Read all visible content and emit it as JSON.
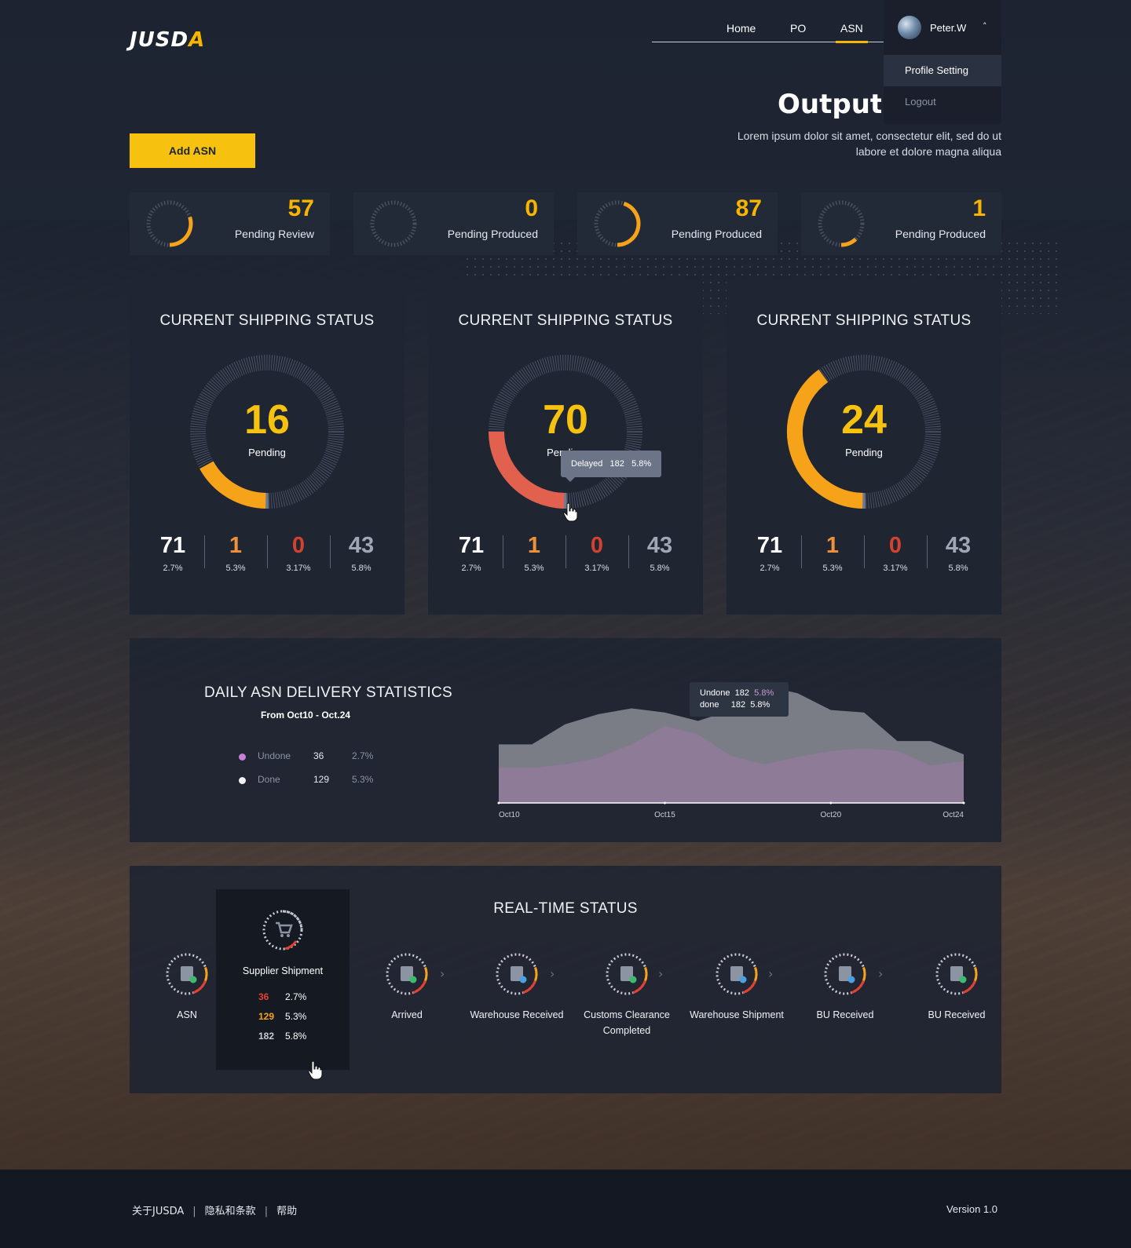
{
  "brand": {
    "logo_text_a": "JUSD",
    "logo_text_b": "A"
  },
  "nav": {
    "items": [
      "Home",
      "PO",
      "ASN"
    ],
    "active": "ASN"
  },
  "user": {
    "name": "Peter.W",
    "menu": [
      "Profile Setting",
      "Logout"
    ]
  },
  "page": {
    "title": "Output S",
    "description_line1": "Lorem ipsum dolor sit amet, consectetur elit, sed do ut",
    "description_line2": "labore et dolore magna aliqua",
    "add_button": "Add ASN"
  },
  "summary": [
    {
      "value": "57",
      "label": "Pending Review",
      "progress": 0.3
    },
    {
      "value": "0",
      "label": "Pending Produced",
      "progress": 0.0
    },
    {
      "value": "87",
      "label": "Pending Produced",
      "progress": 0.45
    },
    {
      "value": "1",
      "label": "Pending Produced",
      "progress": 0.12
    }
  ],
  "shipping_cards": [
    {
      "title": "CURRENT SHIPPING STATUS",
      "value": "16",
      "label": "Pending",
      "ring_fill": 0.17,
      "ring_color": "#f7a31a",
      "stats": [
        {
          "value": "71",
          "pct": "2.7%",
          "color": "#ffffff"
        },
        {
          "value": "1",
          "pct": "5.3%",
          "color": "#f0913a"
        },
        {
          "value": "0",
          "pct": "3.17%",
          "color": "#d4422e"
        },
        {
          "value": "43",
          "pct": "5.8%",
          "color": "#a0a6b4"
        }
      ]
    },
    {
      "title": "CURRENT SHIPPING STATUS",
      "value": "70",
      "label": "Pending",
      "ring_fill": 0.25,
      "ring_color": "#e2614e",
      "stats": [
        {
          "value": "71",
          "pct": "2.7%",
          "color": "#ffffff"
        },
        {
          "value": "1",
          "pct": "5.3%",
          "color": "#f0913a"
        },
        {
          "value": "0",
          "pct": "3.17%",
          "color": "#d4422e"
        },
        {
          "value": "43",
          "pct": "5.8%",
          "color": "#a0a6b4"
        }
      ]
    },
    {
      "title": "CURRENT SHIPPING STATUS",
      "value": "24",
      "label": "Pending",
      "ring_fill": 0.4,
      "ring_color": "#f7a31a",
      "stats": [
        {
          "value": "71",
          "pct": "2.7%",
          "color": "#ffffff"
        },
        {
          "value": "1",
          "pct": "5.3%",
          "color": "#f0913a"
        },
        {
          "value": "0",
          "pct": "3.17%",
          "color": "#d4422e"
        },
        {
          "value": "43",
          "pct": "5.8%",
          "color": "#a0a6b4"
        }
      ]
    }
  ],
  "tooltip_delayed": {
    "label": "Delayed",
    "value": "182",
    "pct": "5.8%"
  },
  "daily": {
    "title": "DAILY ASN DELIVERY STATISTICS",
    "subtitle": "From Oct10 - Oct.24",
    "legend": [
      {
        "name": "Undone",
        "count": "36",
        "pct": "2.7%",
        "color": "#c67fd6"
      },
      {
        "name": "Done",
        "count": "129",
        "pct": "5.3%",
        "color": "#f2f2f2"
      }
    ],
    "tooltip": {
      "undone_label": "Undone",
      "undone_value": "182",
      "undone_pct": "5.8%",
      "done_label": "done",
      "done_value": "182",
      "done_pct": "5.8%"
    }
  },
  "chart_data": {
    "type": "area",
    "x": [
      "Oct10",
      "Oct11",
      "Oct12",
      "Oct13",
      "Oct14",
      "Oct15",
      "Oct16",
      "Oct17",
      "Oct18",
      "Oct19",
      "Oct20",
      "Oct21",
      "Oct22",
      "Oct23",
      "Oct24"
    ],
    "x_ticks": [
      "Oct10",
      "Oct15",
      "Oct20",
      "Oct24"
    ],
    "series": [
      {
        "name": "Undone",
        "values": [
          70,
          70,
          94,
          106,
          113,
          108,
          98,
          111,
          140,
          131,
          111,
          108,
          74,
          74,
          58
        ]
      },
      {
        "name": "done",
        "values": [
          42,
          42,
          46,
          54,
          70,
          92,
          82,
          56,
          46,
          55,
          62,
          65,
          62,
          45,
          50
        ]
      }
    ],
    "ylim": [
      0,
      150
    ],
    "colors": {
      "Undone": "#8a8d95",
      "done": "#8f7b99"
    }
  },
  "realtime": {
    "title": "REAL-TIME STATUS",
    "steps": [
      {
        "label": "ASN",
        "icon": "clipboard-icon"
      },
      {
        "label": "Arrived",
        "icon": "anchor-icon"
      },
      {
        "label": "Warehouse Received",
        "icon": "warehouse-icon"
      },
      {
        "label": "Customs Clearance Completed",
        "label_line1": "Customs Clearance",
        "label_line2": "Completed",
        "icon": "customs-icon"
      },
      {
        "label": "Warehouse Shipment",
        "icon": "warehouse-shipment-icon"
      },
      {
        "label": "BU Received",
        "icon": "truck-icon"
      },
      {
        "label": "BU Received",
        "icon": "truck-icon"
      }
    ],
    "popup": {
      "label": "Supplier Shipment",
      "rows": [
        {
          "value": "36",
          "pct": "2.7%",
          "color": "#e3412f"
        },
        {
          "value": "129",
          "pct": "5.3%",
          "color": "#f7a31a"
        },
        {
          "value": "182",
          "pct": "5.8%",
          "color": "#c8ccd6"
        }
      ]
    }
  },
  "footer": {
    "links": [
      "关于JUSDA",
      "隐私和条款",
      "帮助"
    ],
    "version": "Version 1.0"
  }
}
